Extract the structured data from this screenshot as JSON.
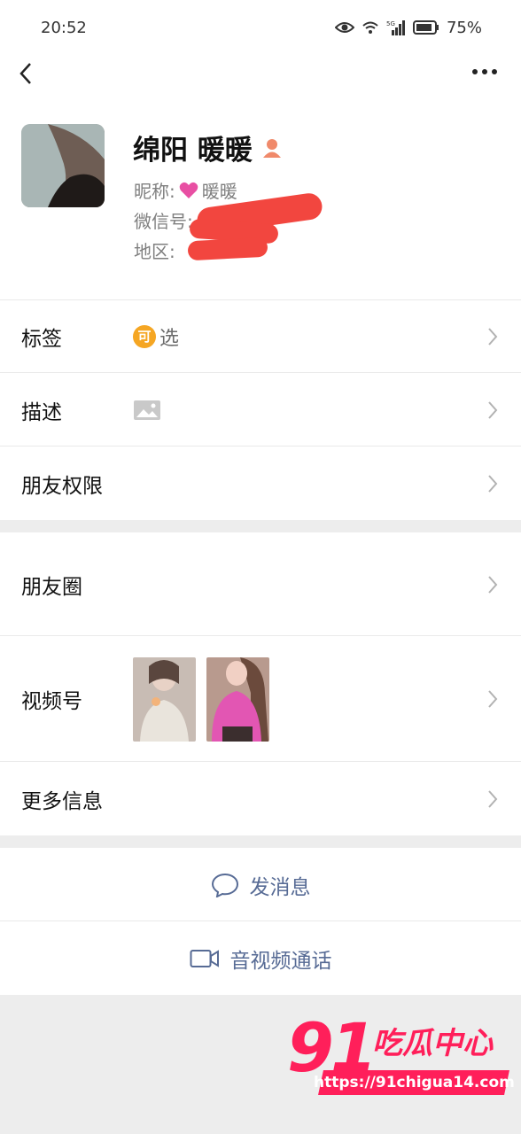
{
  "status_bar": {
    "time": "20:52",
    "battery": "75%",
    "network": "5G"
  },
  "header": {
    "back_icon": "chevron-left-icon",
    "more_icon": "more-dots-icon"
  },
  "profile": {
    "name": "绵阳 暖暖",
    "nickname_label": "昵称:",
    "nickname_value": "暖暖",
    "wechat_id_label": "微信号:",
    "region_label": "地区:"
  },
  "rows": {
    "tags": {
      "label": "标签",
      "value_badge": "可",
      "value_text": "选"
    },
    "description": {
      "label": "描述"
    },
    "friend_permissions": {
      "label": "朋友权限"
    },
    "moments": {
      "label": "朋友圈"
    },
    "channels": {
      "label": "视频号"
    },
    "more_info": {
      "label": "更多信息"
    }
  },
  "actions": {
    "send_message": "发消息",
    "av_call": "音视频通话"
  },
  "watermark": {
    "brand_number": "91",
    "brand_text": "吃瓜中心",
    "url": "https://91chigua14.com"
  },
  "colors": {
    "link": "#576b95",
    "redaction": "#f2463f",
    "watermark": "#ff1f5a",
    "tag_badge": "#f5a623"
  }
}
